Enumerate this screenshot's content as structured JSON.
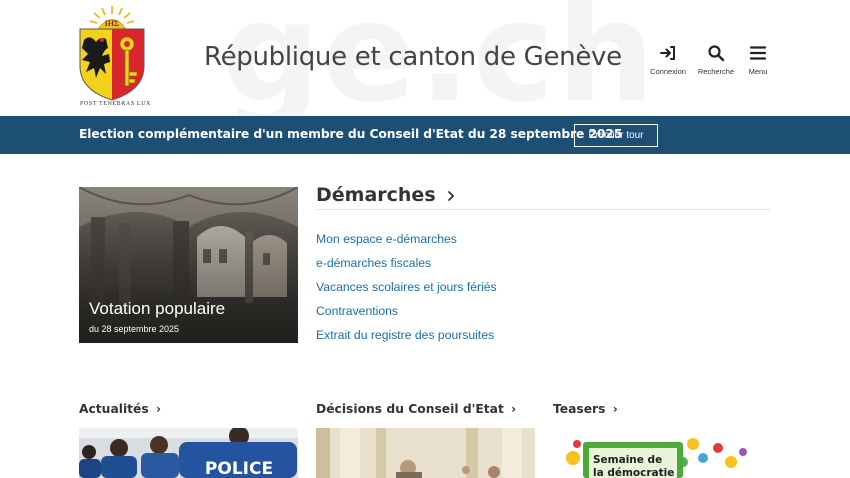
{
  "header": {
    "watermark": "ge.ch",
    "title": "République et canton de Genève",
    "motto": "POST TENEBRAS LUX",
    "logo_lettering": "IHΣ",
    "tools": [
      {
        "label": "Connexion",
        "icon": "login-icon"
      },
      {
        "label": "Recherche",
        "icon": "search-icon"
      },
      {
        "label": "Menu",
        "icon": "menu-icon"
      }
    ]
  },
  "banner": {
    "text": "Election complémentaire d'un membre du Conseil d'Etat du 28 septembre 2025",
    "button": "Premier tour"
  },
  "feature": {
    "title": "Votation populaire",
    "subtitle": "du 28 septembre 2025"
  },
  "demarches": {
    "heading": "Démarches",
    "links": [
      "Mon espace e-démarches",
      "e-démarches fiscales",
      "Vacances scolaires et jours fériés",
      "Contraventions",
      "Extrait du registre des poursuites"
    ]
  },
  "sections": [
    {
      "title": "Actualités"
    },
    {
      "title": "Décisions du Conseil d'Etat"
    },
    {
      "title": "Teasers"
    }
  ],
  "images": {
    "police_text": "POLICE",
    "teaser_text_line1": "Semaine de",
    "teaser_text_line2": "la démocratie"
  },
  "colors": {
    "banner_bg": "#1d4f74",
    "link": "#1a6fa8",
    "text": "#333333",
    "police_blue": "#1f4e93"
  }
}
